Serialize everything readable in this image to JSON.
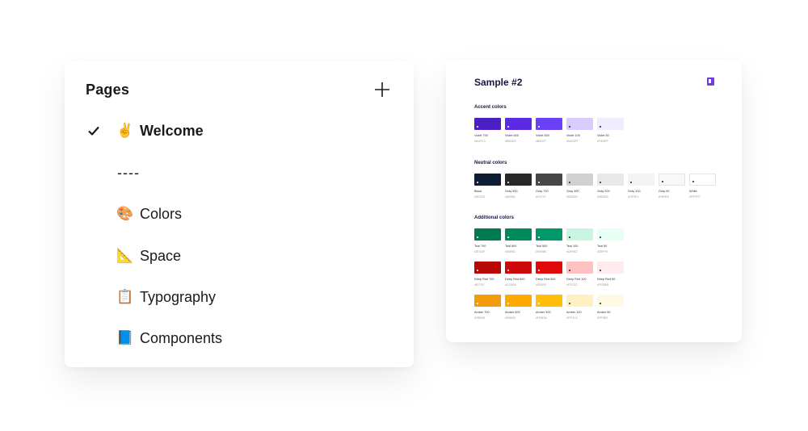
{
  "pages_panel": {
    "title": "Pages",
    "add_label": "+",
    "items": [
      {
        "emoji": "✌️",
        "label": "Welcome",
        "active": true
      },
      {
        "emoji": "",
        "label": "----",
        "active": false
      },
      {
        "emoji": "🎨",
        "label": "Colors",
        "active": false
      },
      {
        "emoji": "📐",
        "label": "Space",
        "active": false
      },
      {
        "emoji": "📋",
        "label": "Typography",
        "active": false
      },
      {
        "emoji": "📘",
        "label": "Components",
        "active": false
      }
    ]
  },
  "sample": {
    "title": "Sample #2",
    "sections": [
      {
        "title": "Accent colors",
        "rows": [
          [
            {
              "name": "Violet 700",
              "hex": "#4A1FC3",
              "color": "#4a1fc3"
            },
            {
              "name": "Violet 600",
              "hex": "#5B2AE3",
              "color": "#5b2ae3"
            },
            {
              "name": "Violet 500",
              "hex": "#6B41F7",
              "color": "#6b41f7"
            },
            {
              "name": "Violet 100",
              "hex": "#DACBFF",
              "color": "#dacbff"
            },
            {
              "name": "Violet 50",
              "hex": "#F0EBFF",
              "color": "#f0ebff"
            }
          ]
        ]
      },
      {
        "title": "Neutral colors",
        "rows": [
          [
            {
              "name": "Black",
              "hex": "#0E1D33",
              "color": "#0e1d33"
            },
            {
              "name": "Gray 900",
              "hex": "#282828",
              "color": "#282828"
            },
            {
              "name": "Gray 700",
              "hex": "#474747",
              "color": "#474747"
            },
            {
              "name": "Gray 300",
              "hex": "#D0D0D0",
              "color": "#d0d0d0"
            },
            {
              "name": "Gray 200",
              "hex": "#E8E8E8",
              "color": "#e8e8e8"
            },
            {
              "name": "Gray 100",
              "hex": "#F3F3F3",
              "color": "#f3f3f3"
            },
            {
              "name": "Gray 50",
              "hex": "#F8F8F8",
              "color": "#f8f8f8"
            },
            {
              "name": "White",
              "hex": "#FFFFFF",
              "color": "#ffffff"
            }
          ]
        ]
      },
      {
        "title": "Additional colors",
        "rows": [
          [
            {
              "name": "Teal 700",
              "hex": "#007A4F",
              "color": "#007a4f"
            },
            {
              "name": "Teal 600",
              "hex": "#00895C",
              "color": "#00895c"
            },
            {
              "name": "Teal 500",
              "hex": "#00996B",
              "color": "#00996b"
            },
            {
              "name": "Teal 100",
              "hex": "#C8F5E2",
              "color": "#c8f5e2"
            },
            {
              "name": "Teal 50",
              "hex": "#E8FFF4",
              "color": "#e8fff4"
            }
          ],
          [
            {
              "name": "Deep Red 700",
              "hex": "#B70707",
              "color": "#b70707"
            },
            {
              "name": "Deep Red 600",
              "hex": "#CC0808",
              "color": "#cc0808"
            },
            {
              "name": "Deep Red 500",
              "hex": "#E00909",
              "color": "#e00909"
            },
            {
              "name": "Deep Red 100",
              "hex": "#FFC2C2",
              "color": "#ffc2c2"
            },
            {
              "name": "Deep Red 50",
              "hex": "#FFEBEB",
              "color": "#ffebeb"
            }
          ],
          [
            {
              "name": "Amber 700",
              "hex": "#F59E0B",
              "color": "#f29b0b"
            },
            {
              "name": "Amber 600",
              "hex": "#FAB000",
              "color": "#faaa00"
            },
            {
              "name": "Amber 500",
              "hex": "#FFBE0A",
              "color": "#ffbe0a"
            },
            {
              "name": "Amber 100",
              "hex": "#FFF1C2",
              "color": "#fff1c2"
            },
            {
              "name": "Amber 50",
              "hex": "#FFF8E2",
              "color": "#fff8e2"
            }
          ]
        ]
      }
    ]
  }
}
